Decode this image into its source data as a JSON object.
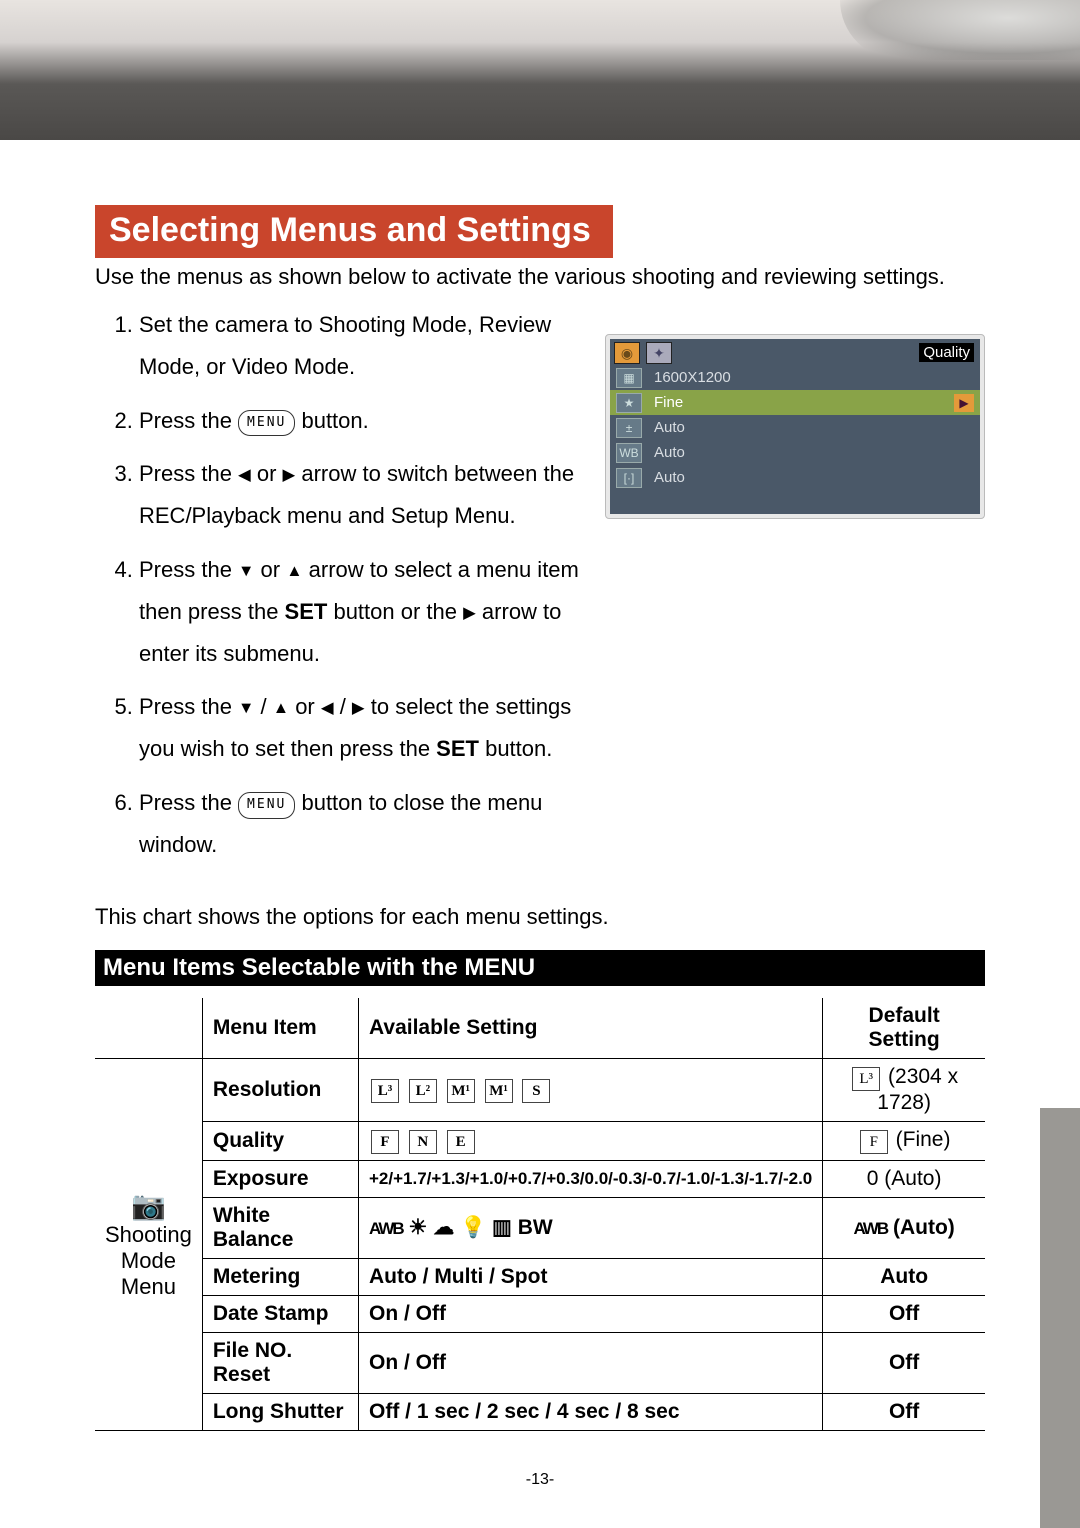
{
  "title": "Selecting Menus and Settings",
  "intro": "Use the menus as shown below to activate the various shooting and reviewing settings.",
  "steps": {
    "s1": "Set the camera to Shooting Mode, Review Mode, or Video Mode.",
    "s2a": "Press the ",
    "s2b": " button.",
    "s3a": "Press the ",
    "s3b": " or ",
    "s3c": " arrow to switch between the REC/Playback menu and Setup Menu.",
    "s4a": "Press the ",
    "s4b": " or ",
    "s4c": " arrow to select a menu item then press the ",
    "s4d": " button or the ",
    "s4e": " arrow to enter its submenu.",
    "s5a": "Press the ",
    "s5b": " / ",
    "s5c": " or ",
    "s5d": " / ",
    "s5e": " to select the settings you wish to set then press the ",
    "s5f": " button.",
    "s6a": "Press the ",
    "s6b": " button to close the menu window.",
    "menu_label": "MENU",
    "set_label": "SET"
  },
  "screenshot": {
    "tab_quality": "Quality",
    "rows": [
      {
        "txt": "1600X1200"
      },
      {
        "txt": "Fine"
      },
      {
        "txt": "Auto"
      },
      {
        "txt": "Auto"
      },
      {
        "txt": "Auto"
      }
    ],
    "icon_ev": "WB",
    "icon_meter": "[·]"
  },
  "chart_intro": "This chart shows the options for each menu settings.",
  "section_bar": "Menu Items Selectable with the MENU",
  "table": {
    "hdr_item": "Menu Item",
    "hdr_avail": "Available Setting",
    "hdr_def": "Default Setting",
    "category": "Shooting Mode Menu",
    "rows": {
      "resolution": {
        "item": "Resolution",
        "def": "(2304 x 1728)"
      },
      "quality": {
        "item": "Quality",
        "def": "(Fine)"
      },
      "exposure": {
        "item": "Exposure",
        "avail": "+2/+1.7/+1.3/+1.0/+0.7/+0.3/0.0/-0.3/-0.7/-1.0/-1.3/-1.7/-2.0",
        "def": "0 (Auto)"
      },
      "wb": {
        "item": "White Balance",
        "def": "(Auto)"
      },
      "metering": {
        "item": "Metering",
        "avail": "Auto / Multi / Spot",
        "def": "Auto"
      },
      "datestamp": {
        "item": "Date Stamp",
        "avail": "On / Off",
        "def": "Off"
      },
      "filereset": {
        "item": "File NO. Reset",
        "avail": "On / Off",
        "def": "Off"
      },
      "longshutter": {
        "item": "Long Shutter",
        "avail": "Off / 1 sec / 2 sec / 4 sec / 8 sec",
        "def": "Off"
      }
    },
    "quality_letters": {
      "f": "F",
      "n": "N",
      "e": "E"
    }
  },
  "page_number": "-13-"
}
